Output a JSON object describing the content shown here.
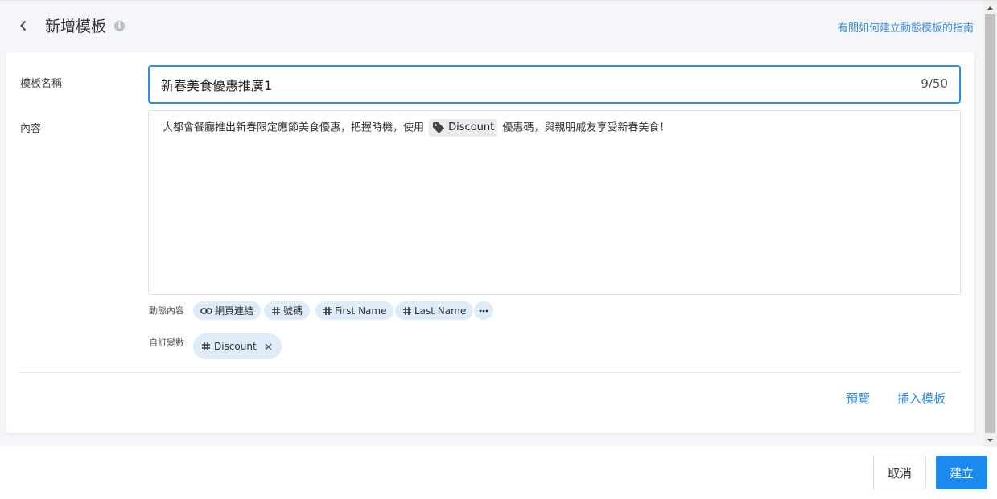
{
  "header": {
    "title": "新增模板",
    "guide_link": "有關如何建立動態模板的指南"
  },
  "form": {
    "name_label": "模板名稱",
    "name_value": "新春美食優惠推廣1",
    "char_count": "9/50",
    "content_label": "內容",
    "content": {
      "text_before": "大都會餐廳推出新春限定應節美食優惠，把握時機，使用",
      "chip_label": "Discount",
      "text_after": "優惠碼，與親朋戚友享受新春美食！"
    },
    "dynamic_label": "動態內容",
    "dynamic_chips": [
      {
        "label": "網頁連結",
        "icon": "link-icon"
      },
      {
        "label": "號碼",
        "icon": "hash-icon"
      },
      {
        "label": "First Name",
        "icon": "hash-icon"
      },
      {
        "label": "Last Name",
        "icon": "hash-icon"
      }
    ],
    "custom_label": "自訂變數",
    "custom_chips": [
      {
        "label": "Discount",
        "icon": "hash-icon"
      }
    ],
    "preview_label": "預覽",
    "insert_label": "插入模板"
  },
  "footer": {
    "cancel_label": "取消",
    "create_label": "建立"
  },
  "colors": {
    "accent": "#2f8ee0",
    "primary_button": "#1a8af0",
    "chip_bg": "#ddecf8",
    "page_bg": "#f5f6fa"
  }
}
